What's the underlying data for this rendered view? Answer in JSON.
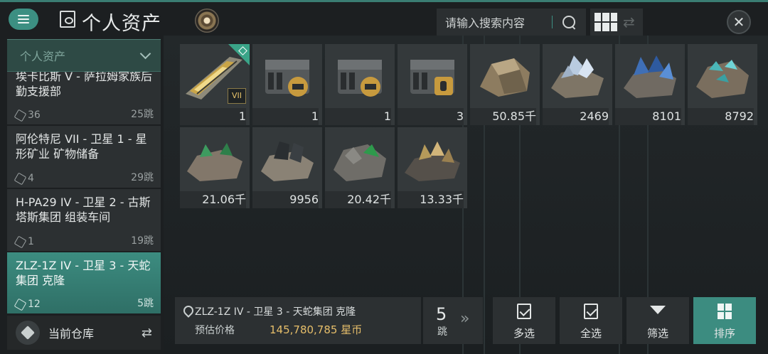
{
  "header": {
    "title": "个人资产",
    "search_placeholder": "请输入搜索内容"
  },
  "sidebar": {
    "dropdown_label": "个人资产",
    "locations": [
      {
        "name": "埃卡比斯 V - 萨拉姆家族后勤支援部",
        "count": "36",
        "jumps": "25跳"
      },
      {
        "name": "阿伦特尼 VII - 卫星 1 - 星形矿业 矿物储备",
        "count": "4",
        "jumps": "29跳"
      },
      {
        "name": "H-PA29 IV - 卫星 2 - 古斯塔斯集团 组装车间",
        "count": "1",
        "jumps": "19跳"
      },
      {
        "name": "ZLZ-1Z IV - 卫星 3 - 天蛇集团 克隆",
        "count": "12",
        "jumps": "5跳"
      }
    ],
    "current_warehouse_label": "当前仓库"
  },
  "items": [
    {
      "qty": "1",
      "icon": "ship-icon",
      "badge": "VII"
    },
    {
      "qty": "1",
      "icon": "crate-icon"
    },
    {
      "qty": "1",
      "icon": "crate-icon"
    },
    {
      "qty": "3",
      "icon": "crate-icon"
    },
    {
      "qty": "50.85千",
      "icon": "ore-icon",
      "color": "#9b8a6e"
    },
    {
      "qty": "2469",
      "icon": "ore-icon",
      "color": "#8fa6b8"
    },
    {
      "qty": "8101",
      "icon": "ore-icon",
      "color": "#3f6fb6"
    },
    {
      "qty": "8792",
      "icon": "ore-icon",
      "color": "#4ab6b8"
    },
    {
      "qty": "21.06千",
      "icon": "ore-icon",
      "color": "#3d9b5f"
    },
    {
      "qty": "9956",
      "icon": "ore-icon",
      "color": "#33383c"
    },
    {
      "qty": "20.42千",
      "icon": "ore-icon",
      "color": "#2e9a4c"
    },
    {
      "qty": "13.33千",
      "icon": "ore-icon",
      "color": "#b59a5a"
    }
  ],
  "footer": {
    "location": "ZLZ-1Z IV - 卫星 3 - 天蛇集团 克隆",
    "estimate_label": "预估价格",
    "estimate_value": "145,780,785 星币",
    "jumps_number": "5",
    "jumps_unit": "跳",
    "actions": {
      "multi_select": "多选",
      "select_all": "全选",
      "filter": "筛选",
      "sort": "排序"
    }
  }
}
